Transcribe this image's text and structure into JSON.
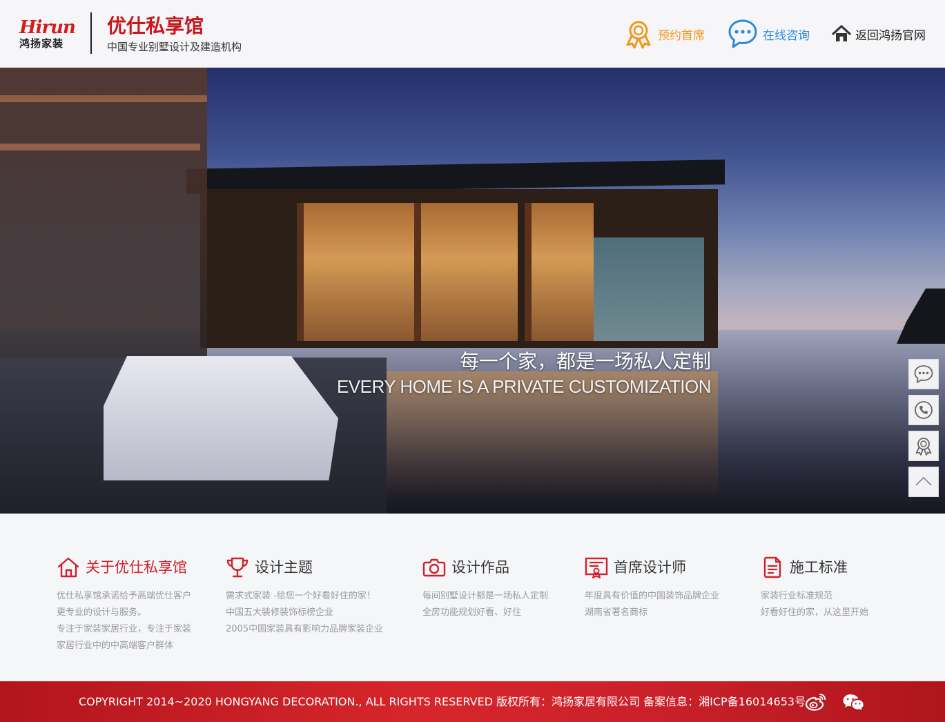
{
  "header": {
    "brand_en": "Hirun",
    "brand_cn": "鸿扬家装",
    "title": "优仕私享馆",
    "subtitle": "中国专业别墅设计及建造机构",
    "nav": {
      "reserve": "预约首席",
      "consult": "在线咨询",
      "home": "返回鸿扬官网"
    }
  },
  "hero": {
    "tagline_cn": "每一个家，都是一场私人定制",
    "tagline_en": "EVERY HOME IS A PRIVATE CUSTOMIZATION"
  },
  "side_bar": {
    "icons": [
      "chat-icon",
      "phone-icon",
      "medal-icon",
      "back-to-top-icon"
    ]
  },
  "features": [
    {
      "title": "关于优仕私享馆",
      "icon": "house-icon",
      "lines": [
        "优仕私享馆承诺给予高端优仕客户",
        "更专业的设计与服务。",
        "专注于家装家居行业，专注于家装",
        "家居行业中的中高端客户群体"
      ]
    },
    {
      "title": "设计主题",
      "icon": "trophy-icon",
      "lines": [
        "需求式家装 -给您一个好看好住的家！",
        "中国五大装修装饰标榜企业",
        "2005中国家装具有影响力品牌家装企业"
      ]
    },
    {
      "title": "设计作品",
      "icon": "camera-icon",
      "lines": [
        "每间别墅设计都是一场私人定制",
        "全房功能规划好看、好住"
      ]
    },
    {
      "title": "首席设计师",
      "icon": "certificate-icon",
      "lines": [
        "年度具有价值的中国装饰品牌企业",
        "湖南省著名商标"
      ]
    },
    {
      "title": "施工标准",
      "icon": "document-icon",
      "lines": [
        "家装行业标准规范",
        "好看好住的家，从这里开始"
      ]
    }
  ],
  "footer": {
    "copyright": "COPYRIGHT 2014~2020 HONGYANG DECORATION., ALL RIGHTS RESERVED 版权所有：鸿扬家居有限公司 备案信息：湘ICP备16014653号"
  },
  "colors": {
    "brand_red": "#d0202a",
    "reserve_orange": "#f0961c",
    "consult_blue": "#2a8ad8",
    "footer_red": "#c9202a"
  }
}
